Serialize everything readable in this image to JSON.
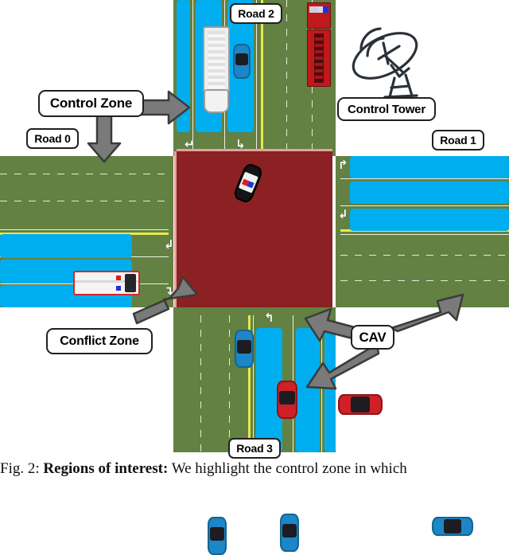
{
  "figure": {
    "caption_prefix": "Fig. 2: ",
    "caption_bold": "Regions of interest:",
    "caption_rest": " We highlight the control zone in which"
  },
  "colors": {
    "grass": "#628142",
    "control_zone_lane": "#00AEEF",
    "conflict_zone": "#8B2122",
    "callout_border": "#231f20",
    "arrow_fill": "#7a7a7a",
    "arrow_stroke": "#3b3b3b",
    "lane_marking": "#efefe0",
    "center_line": "#e8e84a"
  },
  "callouts": [
    {
      "id": "control-zone",
      "label": "Control Zone"
    },
    {
      "id": "control-tower",
      "label": "Control Tower"
    },
    {
      "id": "conflict-zone",
      "label": "Conflict Zone"
    },
    {
      "id": "cav",
      "label": "CAV"
    }
  ],
  "road_labels": [
    {
      "id": "road-0",
      "label": "Road 0"
    },
    {
      "id": "road-1",
      "label": "Road 1"
    },
    {
      "id": "road-2",
      "label": "Road 2"
    },
    {
      "id": "road-3",
      "label": "Road 3"
    }
  ],
  "lane_glyphs": {
    "down_left": "↵",
    "down_right": "↳",
    "left_up": "↱",
    "left_down": "↲",
    "up_right": "↰",
    "right_down": "↴"
  },
  "icons": {
    "control_tower": "satellite-dish-icon"
  },
  "vehicles": [
    {
      "id": "police-car",
      "type": "police",
      "color": "#141418",
      "zone": "conflict-zone"
    },
    {
      "id": "blue-car-conflict",
      "type": "car",
      "color": "#1C86C8",
      "zone": "conflict-zone"
    },
    {
      "id": "red-car-road3",
      "type": "car",
      "color": "#CE2026",
      "zone": "road-3"
    },
    {
      "id": "blue-car-road3-in",
      "type": "car",
      "color": "#1C86C8",
      "zone": "road-3"
    },
    {
      "id": "blue-car-road3-out",
      "type": "car",
      "color": "#1C86C8",
      "zone": "road-3"
    },
    {
      "id": "blue-car-road1",
      "type": "car",
      "color": "#1C86C8",
      "zone": "road-1"
    },
    {
      "id": "red-car-road1",
      "type": "car",
      "color": "#CE2026",
      "zone": "road-1"
    },
    {
      "id": "ambulance-road0",
      "type": "ambulance",
      "color": "#f4f4f4",
      "zone": "road-0"
    },
    {
      "id": "white-truck-road2",
      "type": "truck",
      "color": "#ededed",
      "zone": "road-2"
    },
    {
      "id": "blue-car-road2",
      "type": "car",
      "color": "#1C86C8",
      "zone": "road-2"
    },
    {
      "id": "fire-truck-road2",
      "type": "firetruck",
      "color": "#C0191C",
      "zone": "road-2"
    }
  ]
}
